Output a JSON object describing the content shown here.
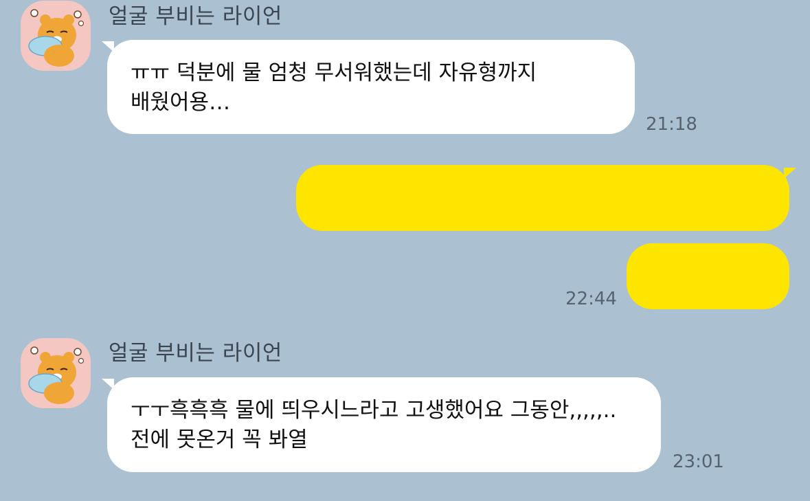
{
  "chat": {
    "groups": [
      {
        "sender": "얼굴 부비는 라이언",
        "message": "ㅠㅠ 덕분에 물 엄청 무서워했는데 자유형까지 배웠어용…",
        "time": "21:18"
      },
      {
        "sender": "얼굴 부비는 라이언",
        "message": "ㅜㅜ흑흑흑 물에 띄우시느라고 고생했어요 그동안,,,,,..전에 못온거 꼭 봐열",
        "time": "23:01"
      }
    ],
    "outgoing": {
      "time": "22:44"
    }
  },
  "colors": {
    "background": "#abc1d1",
    "incoming_bubble": "#ffffff",
    "outgoing_bubble": "#fee500",
    "avatar_bg": "#f5c7c2"
  },
  "icons": {
    "avatar": "ryan-hugging-pillow-sticker"
  }
}
